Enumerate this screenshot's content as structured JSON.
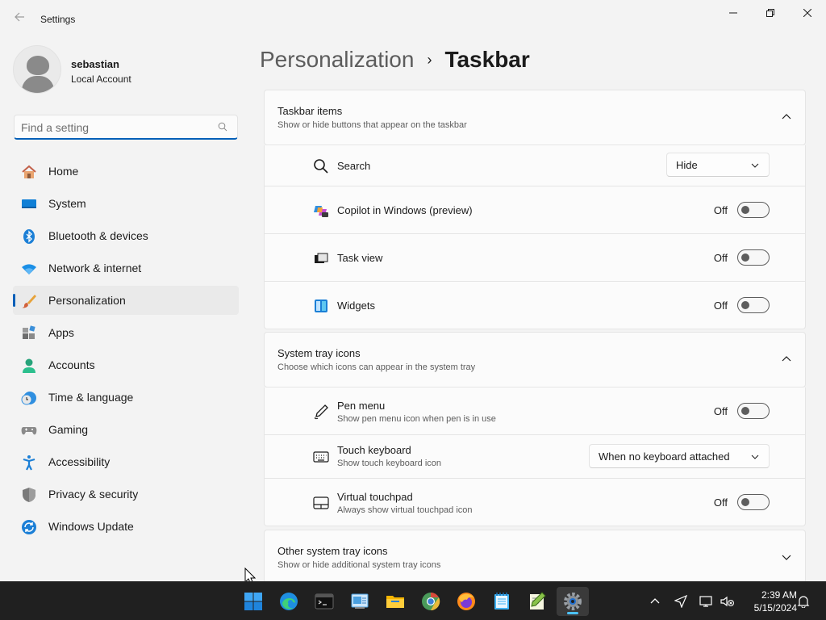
{
  "window": {
    "title": "Settings"
  },
  "user": {
    "name": "sebastian",
    "account_type": "Local Account"
  },
  "search": {
    "placeholder": "Find a setting"
  },
  "sidebar": {
    "items": [
      {
        "label": "Home",
        "icon": "home-icon"
      },
      {
        "label": "System",
        "icon": "system-icon"
      },
      {
        "label": "Bluetooth & devices",
        "icon": "bluetooth-icon"
      },
      {
        "label": "Network & internet",
        "icon": "wifi-icon"
      },
      {
        "label": "Personalization",
        "icon": "brush-icon",
        "active": true
      },
      {
        "label": "Apps",
        "icon": "apps-icon"
      },
      {
        "label": "Accounts",
        "icon": "accounts-icon"
      },
      {
        "label": "Time & language",
        "icon": "clock-globe-icon"
      },
      {
        "label": "Gaming",
        "icon": "gamepad-icon"
      },
      {
        "label": "Accessibility",
        "icon": "accessibility-icon"
      },
      {
        "label": "Privacy & security",
        "icon": "shield-icon"
      },
      {
        "label": "Windows Update",
        "icon": "update-icon"
      }
    ]
  },
  "breadcrumb": {
    "parent": "Personalization",
    "separator": "›",
    "current": "Taskbar"
  },
  "sections": {
    "taskbar_items": {
      "title": "Taskbar items",
      "subtitle": "Show or hide buttons that appear on the taskbar",
      "rows": {
        "search": {
          "label": "Search",
          "value": "Hide"
        },
        "copilot": {
          "label": "Copilot in Windows (preview)",
          "state": "Off"
        },
        "task_view": {
          "label": "Task view",
          "state": "Off"
        },
        "widgets": {
          "label": "Widgets",
          "state": "Off"
        }
      }
    },
    "system_tray": {
      "title": "System tray icons",
      "subtitle": "Choose which icons can appear in the system tray",
      "rows": {
        "pen_menu": {
          "label": "Pen menu",
          "sub": "Show pen menu icon when pen is in use",
          "state": "Off"
        },
        "touch_keyboard": {
          "label": "Touch keyboard",
          "sub": "Show touch keyboard icon",
          "value": "When no keyboard attached"
        },
        "virtual_touchpad": {
          "label": "Virtual touchpad",
          "sub": "Always show virtual touchpad icon",
          "state": "Off"
        }
      }
    },
    "other_tray": {
      "title": "Other system tray icons",
      "subtitle": "Show or hide additional system tray icons"
    }
  },
  "taskbar": {
    "apps": [
      "start-icon",
      "edge-icon",
      "terminal-icon",
      "control-panel-icon",
      "file-explorer-icon",
      "chrome-icon",
      "firefox-icon",
      "notepad-icon",
      "notepadpp-icon",
      "settings-icon"
    ],
    "active_app": "settings-icon",
    "time": "2:39 AM",
    "date": "5/15/2024"
  },
  "colors": {
    "accent": "#005fb8",
    "taskbar_bg": "#202020",
    "window_bg": "#f3f3f3",
    "card_bg": "#fbfbfb"
  }
}
